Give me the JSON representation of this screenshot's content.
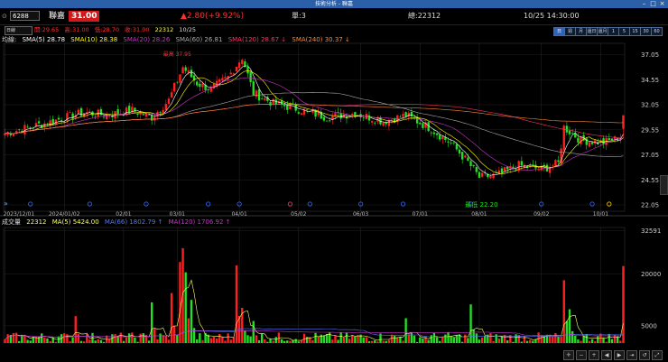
{
  "window": {
    "title": "技術分析 - 聯嘉"
  },
  "quote": {
    "code": "6288",
    "name": "聯嘉",
    "price": "31.00",
    "change": "▲2.80(+9.92%)",
    "unit_label": "單:3",
    "total_label": "總:22312",
    "datetime": "10/25 14:30:00"
  },
  "ohlc": {
    "open": "開:29.65",
    "high": "高:31.00",
    "low": "低:28.70",
    "close": "收:31.00",
    "volume": "22312",
    "date": "10/25"
  },
  "toolbar": {
    "period": "日線",
    "intervals": [
      "日",
      "週",
      "月",
      "還日",
      "還月",
      "1",
      "5",
      "15",
      "30",
      "60"
    ],
    "active_interval": 0
  },
  "legends": {
    "price_label": "均線:",
    "sma": [
      "SMA(5) 28.78",
      "SMA(10) 28.38",
      "SMA(20) 28.26",
      "SMA(60) 26.81",
      "SMA(120) 28.67 ↓",
      "SMA(240) 30.37 ↓"
    ],
    "volume_label": "成交量",
    "vol_value": "22312",
    "vol_ma": [
      "MA(5) 5424.00",
      "MA(66) 1802.79 ↑",
      "MA(120) 1706.92 ↑"
    ]
  },
  "colors": {
    "up": "#ff2020",
    "down": "#22e022",
    "sma5": "#ffffff",
    "sma10": "#ffff00",
    "sma20": "#cc33cc",
    "sma60": "#aaaaaa",
    "sma120": "#ff3366",
    "sma240": "#ff8833",
    "vma5": "#ffff66",
    "vma66": "#5577ff",
    "vma120": "#cc33cc",
    "title_bar": "#2b5fa8"
  },
  "chart_data": {
    "type": "candlestick",
    "x_ticks": [
      "2023/12/01",
      "2024/01/02",
      "02/01",
      "03/01",
      "04/01",
      "05/02",
      "06/03",
      "07/01",
      "08/01",
      "09/02",
      "10/01"
    ],
    "price_axis": [
      37.05,
      34.55,
      32.05,
      29.55,
      27.05,
      24.55,
      22.05
    ],
    "price_range": [
      21.6,
      38.0
    ],
    "volume_axis": [
      32591,
      20000,
      5000
    ],
    "volume_range": [
      0,
      33500
    ],
    "annotations": [
      {
        "text": "最高 37.95",
        "note": "high"
      },
      {
        "text": "最低 22.20",
        "note": "low"
      }
    ],
    "anchors": [
      {
        "i": 0,
        "c": 29.2
      },
      {
        "i": 10,
        "c": 29.9
      },
      {
        "i": 18,
        "c": 30.5
      },
      {
        "i": 28,
        "c": 31.3
      },
      {
        "i": 36,
        "c": 31.0
      },
      {
        "i": 45,
        "c": 31.5
      },
      {
        "i": 52,
        "c": 30.8
      },
      {
        "i": 58,
        "c": 32.5
      },
      {
        "i": 63,
        "c": 35.8
      },
      {
        "i": 68,
        "c": 34.2
      },
      {
        "i": 73,
        "c": 33.6
      },
      {
        "i": 79,
        "c": 34.8
      },
      {
        "i": 84,
        "c": 36.8
      },
      {
        "i": 88,
        "c": 33.2
      },
      {
        "i": 95,
        "c": 32.2
      },
      {
        "i": 104,
        "c": 31.6
      },
      {
        "i": 114,
        "c": 30.8
      },
      {
        "i": 124,
        "c": 31.2
      },
      {
        "i": 134,
        "c": 30.4
      },
      {
        "i": 142,
        "c": 31.0
      },
      {
        "i": 150,
        "c": 29.8
      },
      {
        "i": 158,
        "c": 28.2
      },
      {
        "i": 164,
        "c": 26.3
      },
      {
        "i": 168,
        "c": 24.8
      },
      {
        "i": 174,
        "c": 25.0
      },
      {
        "i": 182,
        "c": 26.0
      },
      {
        "i": 190,
        "c": 25.6
      },
      {
        "i": 196,
        "c": 26.2
      },
      {
        "i": 198,
        "c": 29.8
      },
      {
        "i": 204,
        "c": 28.5
      },
      {
        "i": 212,
        "c": 28.3
      },
      {
        "i": 216,
        "c": 28.6
      },
      {
        "i": 218,
        "c": 28.9
      }
    ],
    "last": {
      "open": 29.65,
      "high": 31.0,
      "low": 28.7,
      "close": 31.0,
      "volume": 22312
    },
    "vol_spikes": [
      {
        "i": 25,
        "v": 7800
      },
      {
        "i": 52,
        "v": 11800
      },
      {
        "i": 59,
        "v": 14500
      },
      {
        "i": 62,
        "v": 23500
      },
      {
        "i": 63,
        "v": 27500
      },
      {
        "i": 64,
        "v": 20500
      },
      {
        "i": 66,
        "v": 12500
      },
      {
        "i": 82,
        "v": 22500
      },
      {
        "i": 84,
        "v": 10200
      },
      {
        "i": 88,
        "v": 6400
      },
      {
        "i": 142,
        "v": 7200
      },
      {
        "i": 165,
        "v": 11200
      },
      {
        "i": 198,
        "v": 18200
      },
      {
        "i": 200,
        "v": 9800
      }
    ],
    "n_bars": 220
  }
}
